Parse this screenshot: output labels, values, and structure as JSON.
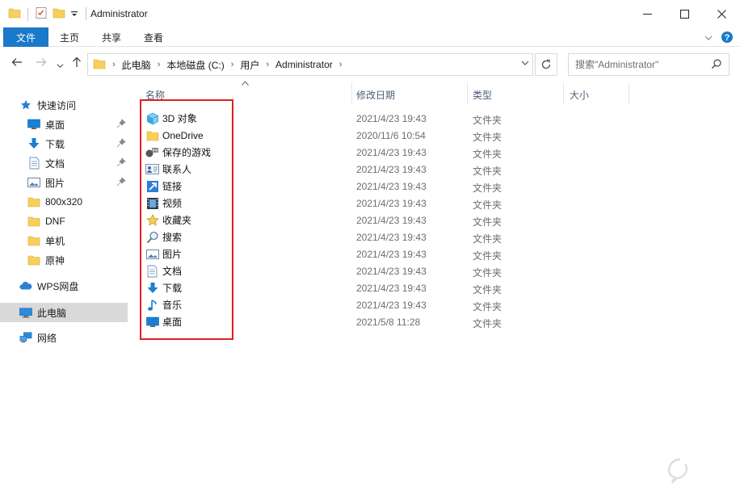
{
  "window": {
    "title": "Administrator"
  },
  "ribbon": {
    "tabs": [
      {
        "label": "文件",
        "active": true
      },
      {
        "label": "主页",
        "active": false
      },
      {
        "label": "共享",
        "active": false
      },
      {
        "label": "查看",
        "active": false
      }
    ]
  },
  "address": {
    "crumbs": [
      "此电脑",
      "本地磁盘 (C:)",
      "用户",
      "Administrator"
    ]
  },
  "search": {
    "placeholder": "搜索\"Administrator\""
  },
  "sidebar": {
    "items": [
      {
        "label": "快速访问",
        "icon": "star-icon",
        "pinned": false
      },
      {
        "label": "桌面",
        "icon": "desktop-icon",
        "pinned": true
      },
      {
        "label": "下载",
        "icon": "download-icon",
        "pinned": true
      },
      {
        "label": "文档",
        "icon": "document-icon",
        "pinned": true
      },
      {
        "label": "图片",
        "icon": "picture-icon",
        "pinned": true
      },
      {
        "label": "800x320",
        "icon": "folder-icon",
        "pinned": false
      },
      {
        "label": "DNF",
        "icon": "folder-icon",
        "pinned": false
      },
      {
        "label": "单机",
        "icon": "folder-icon",
        "pinned": false
      },
      {
        "label": "原神",
        "icon": "folder-icon",
        "pinned": false
      },
      {
        "label": "WPS网盘",
        "icon": "cloud-icon",
        "pinned": false
      },
      {
        "label": "此电脑",
        "icon": "computer-icon",
        "pinned": false,
        "selected": true
      },
      {
        "label": "网络",
        "icon": "network-icon",
        "pinned": false
      }
    ]
  },
  "columns": {
    "name": "名称",
    "date": "修改日期",
    "type": "类型",
    "size": "大小"
  },
  "files": [
    {
      "name": "3D 对象",
      "date": "2021/4/23 19:43",
      "type": "文件夹",
      "icon": "3d-objects-icon"
    },
    {
      "name": "OneDrive",
      "date": "2020/11/6 10:54",
      "type": "文件夹",
      "icon": "folder-icon"
    },
    {
      "name": "保存的游戏",
      "date": "2021/4/23 19:43",
      "type": "文件夹",
      "icon": "saved-games-icon"
    },
    {
      "name": "联系人",
      "date": "2021/4/23 19:43",
      "type": "文件夹",
      "icon": "contacts-icon"
    },
    {
      "name": "链接",
      "date": "2021/4/23 19:43",
      "type": "文件夹",
      "icon": "links-icon"
    },
    {
      "name": "视频",
      "date": "2021/4/23 19:43",
      "type": "文件夹",
      "icon": "videos-icon"
    },
    {
      "name": "收藏夹",
      "date": "2021/4/23 19:43",
      "type": "文件夹",
      "icon": "favorites-icon"
    },
    {
      "name": "搜索",
      "date": "2021/4/23 19:43",
      "type": "文件夹",
      "icon": "searches-icon"
    },
    {
      "name": "图片",
      "date": "2021/4/23 19:43",
      "type": "文件夹",
      "icon": "pictures-icon"
    },
    {
      "name": "文档",
      "date": "2021/4/23 19:43",
      "type": "文件夹",
      "icon": "documents-icon"
    },
    {
      "name": "下载",
      "date": "2021/4/23 19:43",
      "type": "文件夹",
      "icon": "downloads-icon"
    },
    {
      "name": "音乐",
      "date": "2021/4/23 19:43",
      "type": "文件夹",
      "icon": "music-icon"
    },
    {
      "name": "桌面",
      "date": "2021/5/8 11:28",
      "type": "文件夹",
      "icon": "desktop-icon"
    }
  ],
  "colors": {
    "accent": "#1979ca",
    "highlight_box": "#e0201f",
    "folder": "#f7cf5a"
  }
}
